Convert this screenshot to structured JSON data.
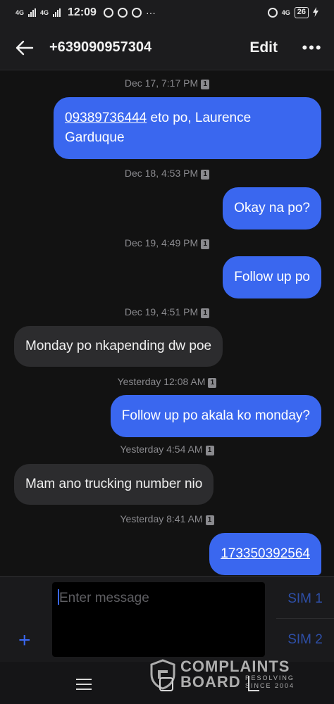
{
  "status": {
    "net1": "4G",
    "net2": "4G",
    "time": "12:09",
    "more": "···",
    "net_right": "4G",
    "battery": "26"
  },
  "header": {
    "title": "+639090957304",
    "edit_label": "Edit",
    "more_label": "•••"
  },
  "messages": [
    {
      "timestamp": "Dec 17, 7:17 PM",
      "sim": "1",
      "direction": "out",
      "link": "09389736444",
      "text": " eto po, Laurence Garduque"
    },
    {
      "timestamp": "Dec 18, 4:53 PM",
      "sim": "1",
      "direction": "out",
      "text": "Okay na po?"
    },
    {
      "timestamp": "Dec 19, 4:49 PM",
      "sim": "1",
      "direction": "out",
      "text": "Follow up po"
    },
    {
      "timestamp": "Dec 19, 4:51 PM",
      "sim": "1",
      "direction": "in",
      "text": "Monday po nkapending dw poe"
    },
    {
      "timestamp": "Yesterday 12:08 AM",
      "sim": "1",
      "direction": "out",
      "text": "Follow up po akala ko monday?"
    },
    {
      "timestamp": "Yesterday 4:54 AM",
      "sim": "1",
      "direction": "in",
      "text": "Mam ano trucking number nio"
    },
    {
      "timestamp": "Yesterday 8:41 AM",
      "sim": "1",
      "direction": "out",
      "link": "173350392564",
      "text": ""
    }
  ],
  "composer": {
    "placeholder": "Enter message",
    "sim1_label": "SIM 1",
    "sim2_label": "SIM 2",
    "add_label": "+"
  },
  "watermark": {
    "line1": "COMPLAINTS",
    "line2": "BOARD",
    "line3": "RESOLVING SINCE 2004"
  },
  "colors": {
    "accent": "#3a67ef",
    "background": "#121212",
    "incoming_bubble": "#2c2c2e"
  }
}
